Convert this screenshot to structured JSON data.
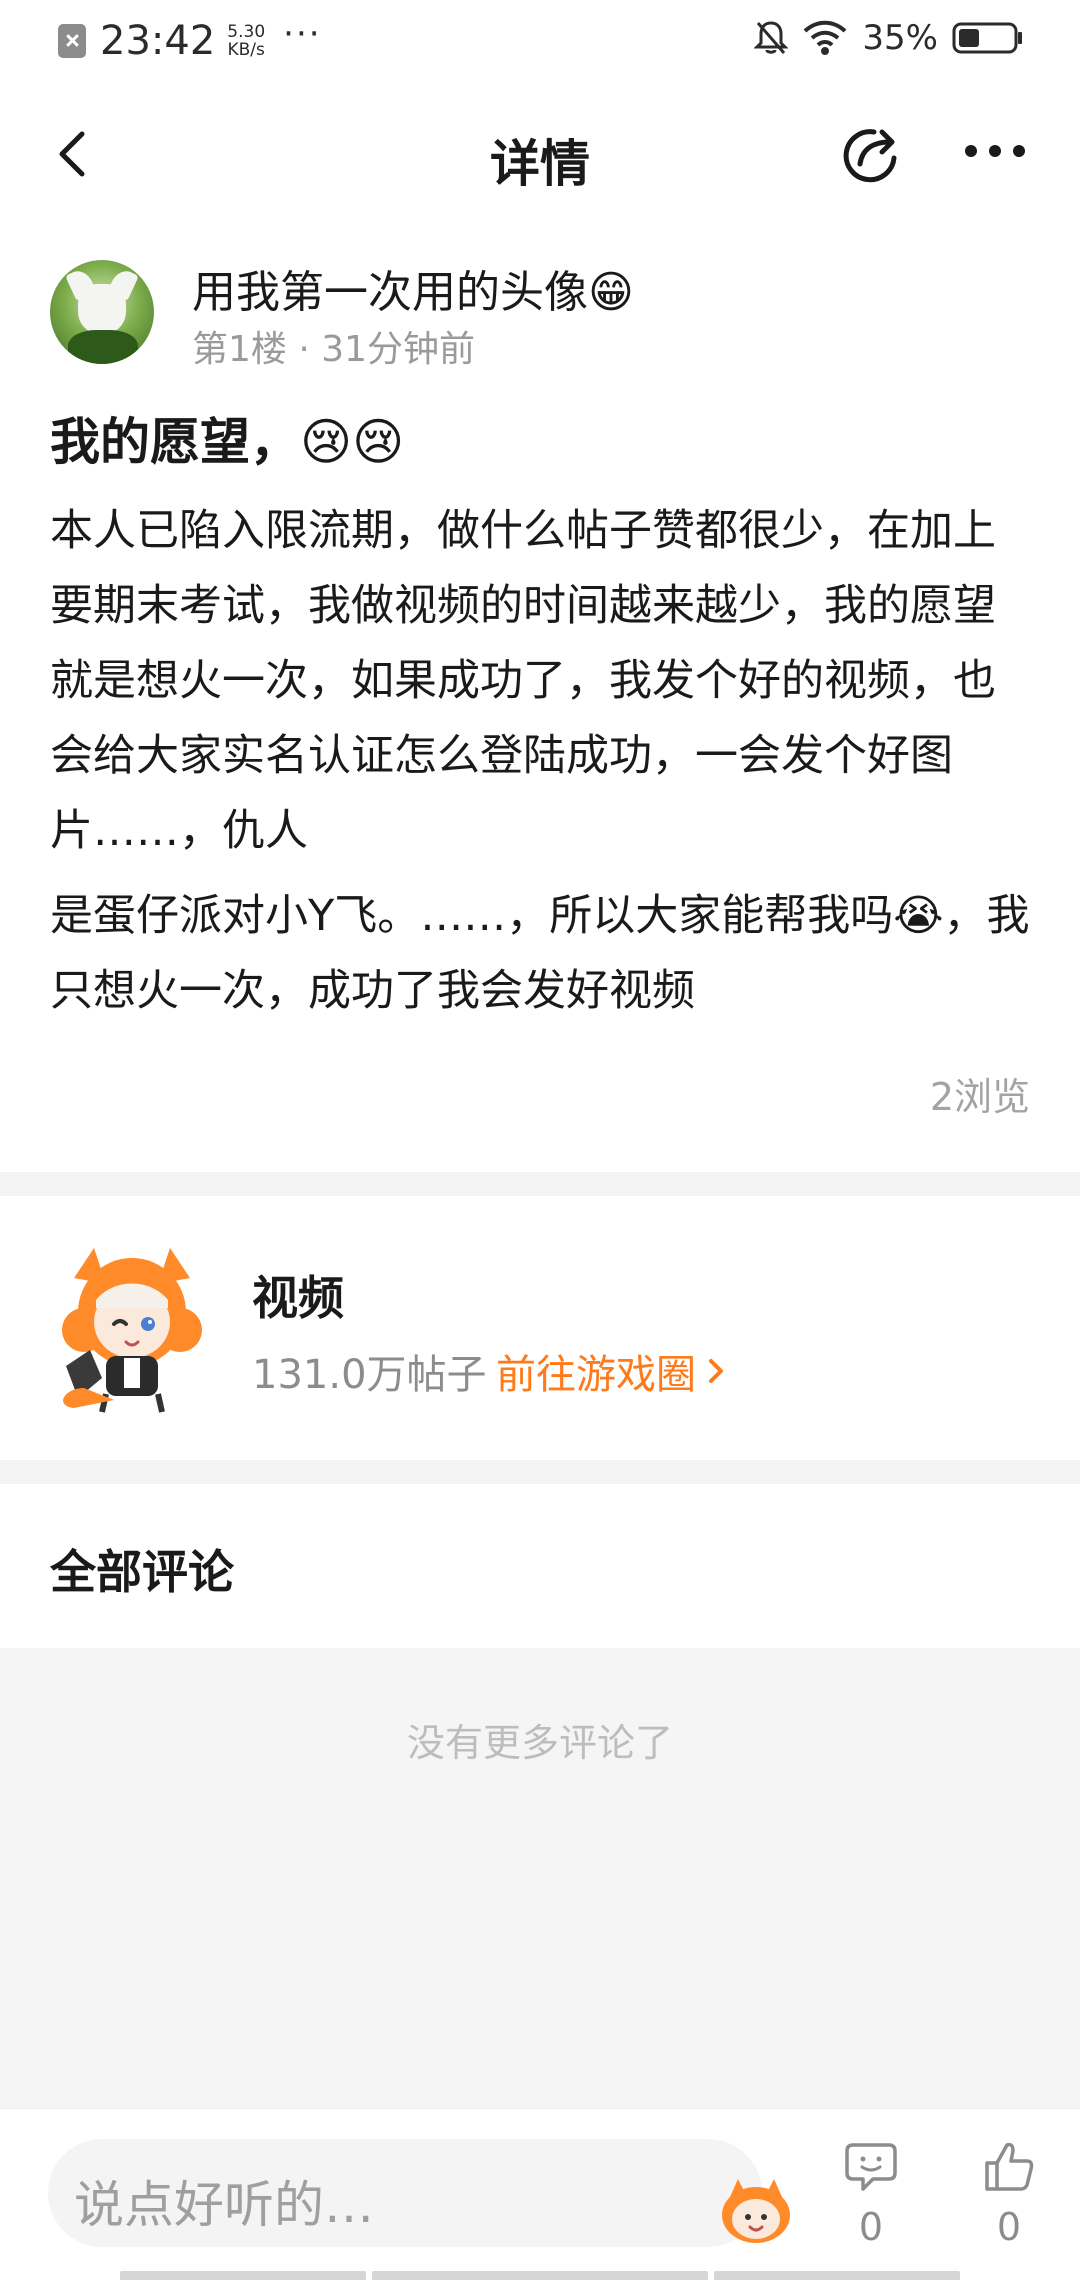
{
  "status_bar": {
    "time": "23:42",
    "speed_value": "5.30",
    "speed_unit": "KB/s",
    "more": "···",
    "battery": "35%"
  },
  "nav": {
    "title": "详情"
  },
  "post": {
    "author": "用我第一次用的头像😁",
    "floor": "第1楼",
    "time_ago": "31分钟前",
    "title": "我的愿望，😢😢",
    "paragraph1": "本人已陷入限流期，做什么帖子赞都很少，在加上要期末考试，我做视频的时间越来越少，我的愿望就是想火一次，如果成功了，我发个好的视频，也会给大家实名认证怎么登陆成功，一会发个好图片……，仇人",
    "paragraph2": "是蛋仔派对小Y飞。……，所以大家能帮我吗😭，我只想火一次，成功了我会发好视频",
    "views": "2浏览"
  },
  "circle": {
    "name": "视频",
    "post_count": "131.0万帖子",
    "link": "前往游戏圈"
  },
  "comments": {
    "heading": "全部评论",
    "empty_text": "没有更多评论了"
  },
  "bottom_bar": {
    "input_placeholder": "说点好听的…",
    "comment_count": "0",
    "like_count": "0"
  },
  "colors": {
    "accent": "#ff7a1a",
    "text_primary": "#1a1a1a",
    "text_secondary": "#9a9a9a",
    "divider": "#f3f3f3"
  }
}
